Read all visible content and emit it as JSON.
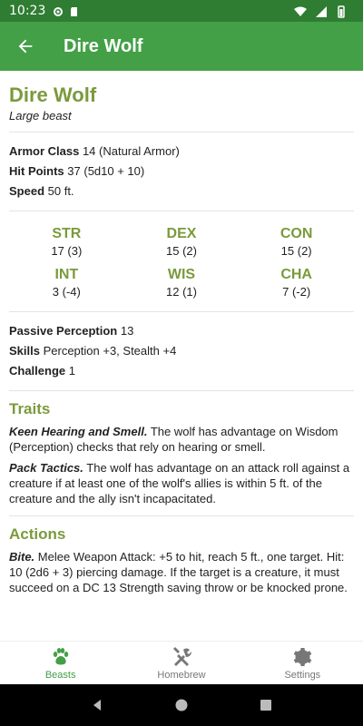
{
  "status_bar": {
    "time": "10:23"
  },
  "app_bar": {
    "title": "Dire Wolf"
  },
  "creature": {
    "name": "Dire Wolf",
    "type": "Large beast",
    "armor_class_label": "Armor Class",
    "armor_class_value": "14 (Natural Armor)",
    "hit_points_label": "Hit Points",
    "hit_points_value": "37 (5d10 + 10)",
    "speed_label": "Speed",
    "speed_value": "50 ft.",
    "abilities": [
      {
        "name": "STR",
        "value": "17 (3)"
      },
      {
        "name": "DEX",
        "value": "15 (2)"
      },
      {
        "name": "CON",
        "value": "15 (2)"
      },
      {
        "name": "INT",
        "value": "3 (-4)"
      },
      {
        "name": "WIS",
        "value": "12 (1)"
      },
      {
        "name": "CHA",
        "value": "7 (-2)"
      }
    ],
    "passive_perception_label": "Passive Perception",
    "passive_perception_value": "13",
    "skills_label": "Skills",
    "skills_value": "Perception +3, Stealth +4",
    "challenge_label": "Challenge",
    "challenge_value": "1"
  },
  "traits": {
    "title": "Traits",
    "items": [
      {
        "name": "Keen Hearing and Smell.",
        "text": "The wolf has advantage on Wisdom (Perception) checks that rely on hearing or smell."
      },
      {
        "name": "Pack Tactics.",
        "text": "The wolf has advantage on an attack roll against a creature if at least one of the wolf's allies is within 5 ft. of the creature and the ally isn't incapacitated."
      }
    ]
  },
  "actions": {
    "title": "Actions",
    "items": [
      {
        "name": "Bite.",
        "text": "Melee Weapon Attack: +5 to hit, reach 5 ft., one target. Hit: 10 (2d6 + 3) piercing damage. If the target is a creature, it must succeed on a DC 13 Strength saving throw or be knocked prone."
      }
    ]
  },
  "bottom_nav": {
    "items": [
      {
        "label": "Beasts",
        "icon": "paw-icon",
        "active": true
      },
      {
        "label": "Homebrew",
        "icon": "tools-icon",
        "active": false
      },
      {
        "label": "Settings",
        "icon": "gear-icon",
        "active": false
      }
    ]
  },
  "colors": {
    "app_bar": "#43a047",
    "status_bar": "#2e7d32",
    "heading": "#7b9a3c",
    "active_nav": "#43a047"
  }
}
